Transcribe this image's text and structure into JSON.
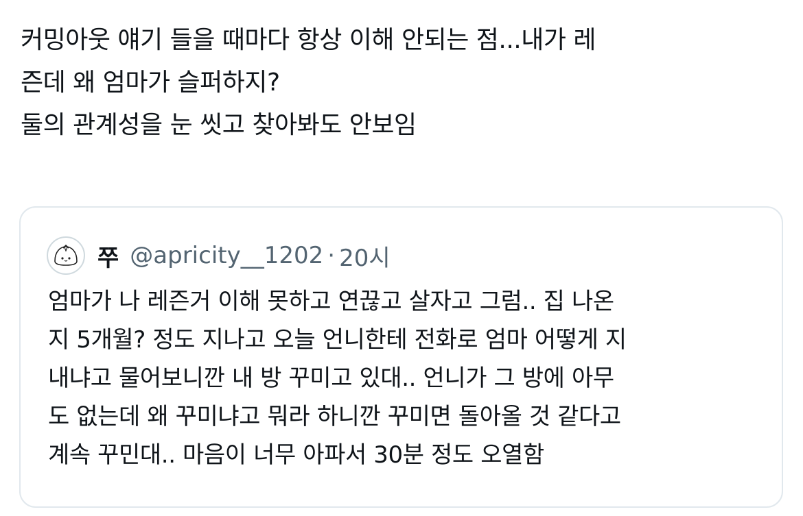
{
  "tweet": {
    "lines": [
      "커밍아웃 얘기 들을 때마다 항상 이해 안되는 점...내가 레",
      "즌데 왜 엄마가 슬퍼하지?",
      "둘의 관계성을 눈 씻고 찾아봐도 안보임"
    ]
  },
  "quote": {
    "avatar_icon": "dumpling-character-icon",
    "display_name": "쭈",
    "handle": "@apricity__1202",
    "separator": "·",
    "time": "20시",
    "lines": [
      "엄마가 나 레즌거 이해 못하고 연끊고 살자고 그럼.. 집 나온",
      "지 5개월? 정도 지나고 오늘 언니한테 전화로 엄마 어떻게 지",
      "내냐고 물어보니깐 내 방 꾸미고 있대.. 언니가 그 방에 아무",
      "도 없는데 왜 꾸미냐고 뭐라 하니깐 꾸미면 돌아올 것 같다고",
      "계속 꾸민대.. 마음이 너무 아파서 30분 정도 오열함"
    ]
  },
  "colors": {
    "text": "#0f1419",
    "secondary": "#536471",
    "border": "#e1e8ed"
  }
}
